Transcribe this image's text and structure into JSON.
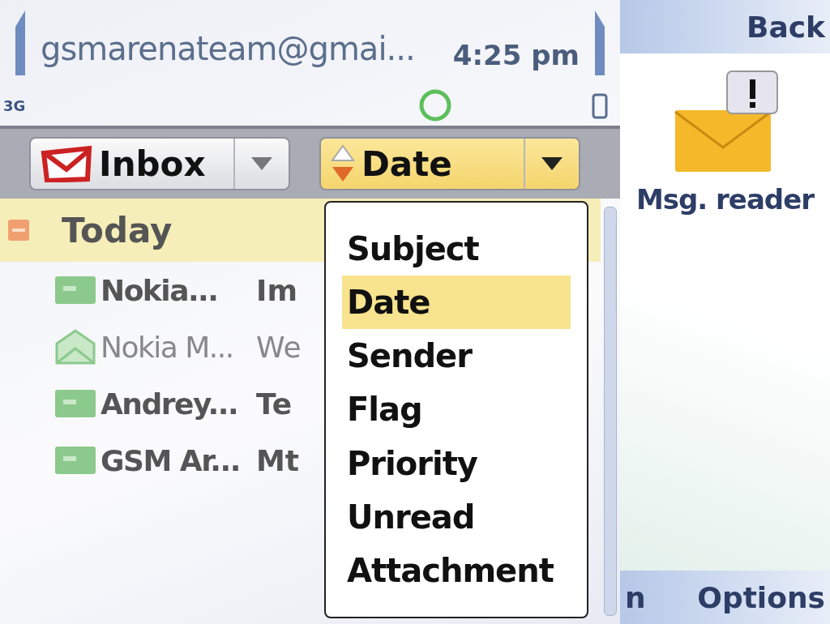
{
  "status_bar": {
    "account": "gsmarenateam@gmai...",
    "network": "3G",
    "time": "4:25 pm"
  },
  "toolbar": {
    "folder": {
      "label": "Inbox"
    },
    "sort": {
      "label": "Date",
      "open": true
    }
  },
  "group": {
    "label": "Today",
    "expanded": true
  },
  "messages": [
    {
      "sender": "Nokia...",
      "subject": "Im",
      "unread": true
    },
    {
      "sender": "Nokia M...",
      "subject": "We",
      "unread": false
    },
    {
      "sender": "Andrey...",
      "subject": "Te",
      "unread": true
    },
    {
      "sender": "GSM Ar...",
      "subject": "Mt",
      "unread": true
    }
  ],
  "sort_menu": [
    {
      "label": "Subject",
      "selected": false
    },
    {
      "label": "Date",
      "selected": true
    },
    {
      "label": "Sender",
      "selected": false
    },
    {
      "label": "Flag",
      "selected": false
    },
    {
      "label": "Priority",
      "selected": false
    },
    {
      "label": "Unread",
      "selected": false
    },
    {
      "label": "Attachment",
      "selected": false
    }
  ],
  "side_panel": {
    "softkey_top": "Back",
    "app_label": "Msg. reader",
    "softkey_left": "n",
    "softkey_right": "Options"
  }
}
